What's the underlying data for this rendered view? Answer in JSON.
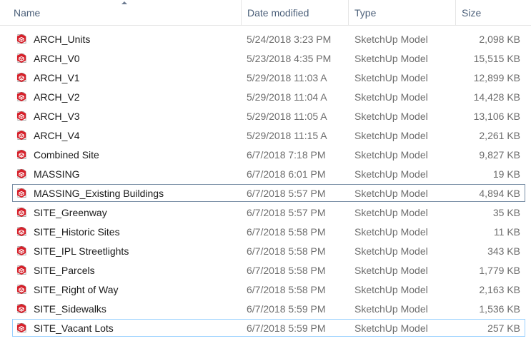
{
  "columns": {
    "name": "Name",
    "date": "Date modified",
    "type": "Type",
    "size": "Size"
  },
  "icon": "sketchup-file-icon",
  "accent_color": "#d6202a",
  "files": [
    {
      "name": "ARCH_Units",
      "date": "5/24/2018 3:23 PM",
      "type": "SketchUp Model",
      "size": "2,098 KB"
    },
    {
      "name": "ARCH_V0",
      "date": "5/23/2018 4:35 PM",
      "type": "SketchUp Model",
      "size": "15,515 KB"
    },
    {
      "name": "ARCH_V1",
      "date": "5/29/2018 11:03 A",
      "type": "SketchUp Model",
      "size": "12,899 KB"
    },
    {
      "name": "ARCH_V2",
      "date": "5/29/2018 11:04 A",
      "type": "SketchUp Model",
      "size": "14,428 KB"
    },
    {
      "name": "ARCH_V3",
      "date": "5/29/2018 11:05 A",
      "type": "SketchUp Model",
      "size": "13,106 KB"
    },
    {
      "name": "ARCH_V4",
      "date": "5/29/2018 11:15 A",
      "type": "SketchUp Model",
      "size": "2,261 KB"
    },
    {
      "name": "Combined Site",
      "date": "6/7/2018 7:18 PM",
      "type": "SketchUp Model",
      "size": "9,827 KB"
    },
    {
      "name": "MASSING",
      "date": "6/7/2018 6:01 PM",
      "type": "SketchUp Model",
      "size": "19 KB"
    },
    {
      "name": "MASSING_Existing Buildings",
      "date": "6/7/2018 5:57 PM",
      "type": "SketchUp Model",
      "size": "4,894 KB"
    },
    {
      "name": "SITE_Greenway",
      "date": "6/7/2018 5:57 PM",
      "type": "SketchUp Model",
      "size": "35 KB"
    },
    {
      "name": "SITE_Historic Sites",
      "date": "6/7/2018 5:58 PM",
      "type": "SketchUp Model",
      "size": "11 KB"
    },
    {
      "name": "SITE_IPL Streetlights",
      "date": "6/7/2018 5:58 PM",
      "type": "SketchUp Model",
      "size": "343 KB"
    },
    {
      "name": "SITE_Parcels",
      "date": "6/7/2018 5:58 PM",
      "type": "SketchUp Model",
      "size": "1,779 KB"
    },
    {
      "name": "SITE_Right of Way",
      "date": "6/7/2018 5:58 PM",
      "type": "SketchUp Model",
      "size": "2,163 KB"
    },
    {
      "name": "SITE_Sidewalks",
      "date": "6/7/2018 5:59 PM",
      "type": "SketchUp Model",
      "size": "1,536 KB"
    },
    {
      "name": "SITE_Vacant Lots",
      "date": "6/7/2018 5:59 PM",
      "type": "SketchUp Model",
      "size": "257 KB"
    }
  ]
}
